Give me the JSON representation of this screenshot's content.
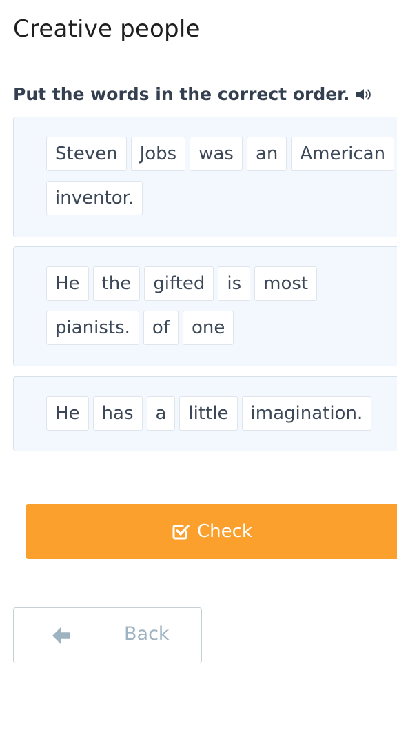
{
  "page": {
    "title": "Creative people",
    "instruction": "Put the words in the correct order."
  },
  "exercises": [
    {
      "words": [
        "Steven",
        "Jobs",
        "was",
        "an",
        "American",
        "inventor."
      ]
    },
    {
      "words": [
        "He",
        "the",
        "gifted",
        "is",
        "most",
        "pianists.",
        "of",
        "one"
      ]
    },
    {
      "words": [
        "He",
        "has",
        "a",
        "little",
        "imagination."
      ]
    }
  ],
  "buttons": {
    "check_label": "Check",
    "back_label": "Back"
  },
  "icons": {
    "instruction": "speaker-icon",
    "check": "checkbox-check-icon",
    "back": "arrow-left-icon"
  },
  "colors": {
    "accent": "#fba02d",
    "card_background": "#f2f8fd",
    "title_text": "#1e1e1e",
    "back_text": "#9eb3c2"
  }
}
